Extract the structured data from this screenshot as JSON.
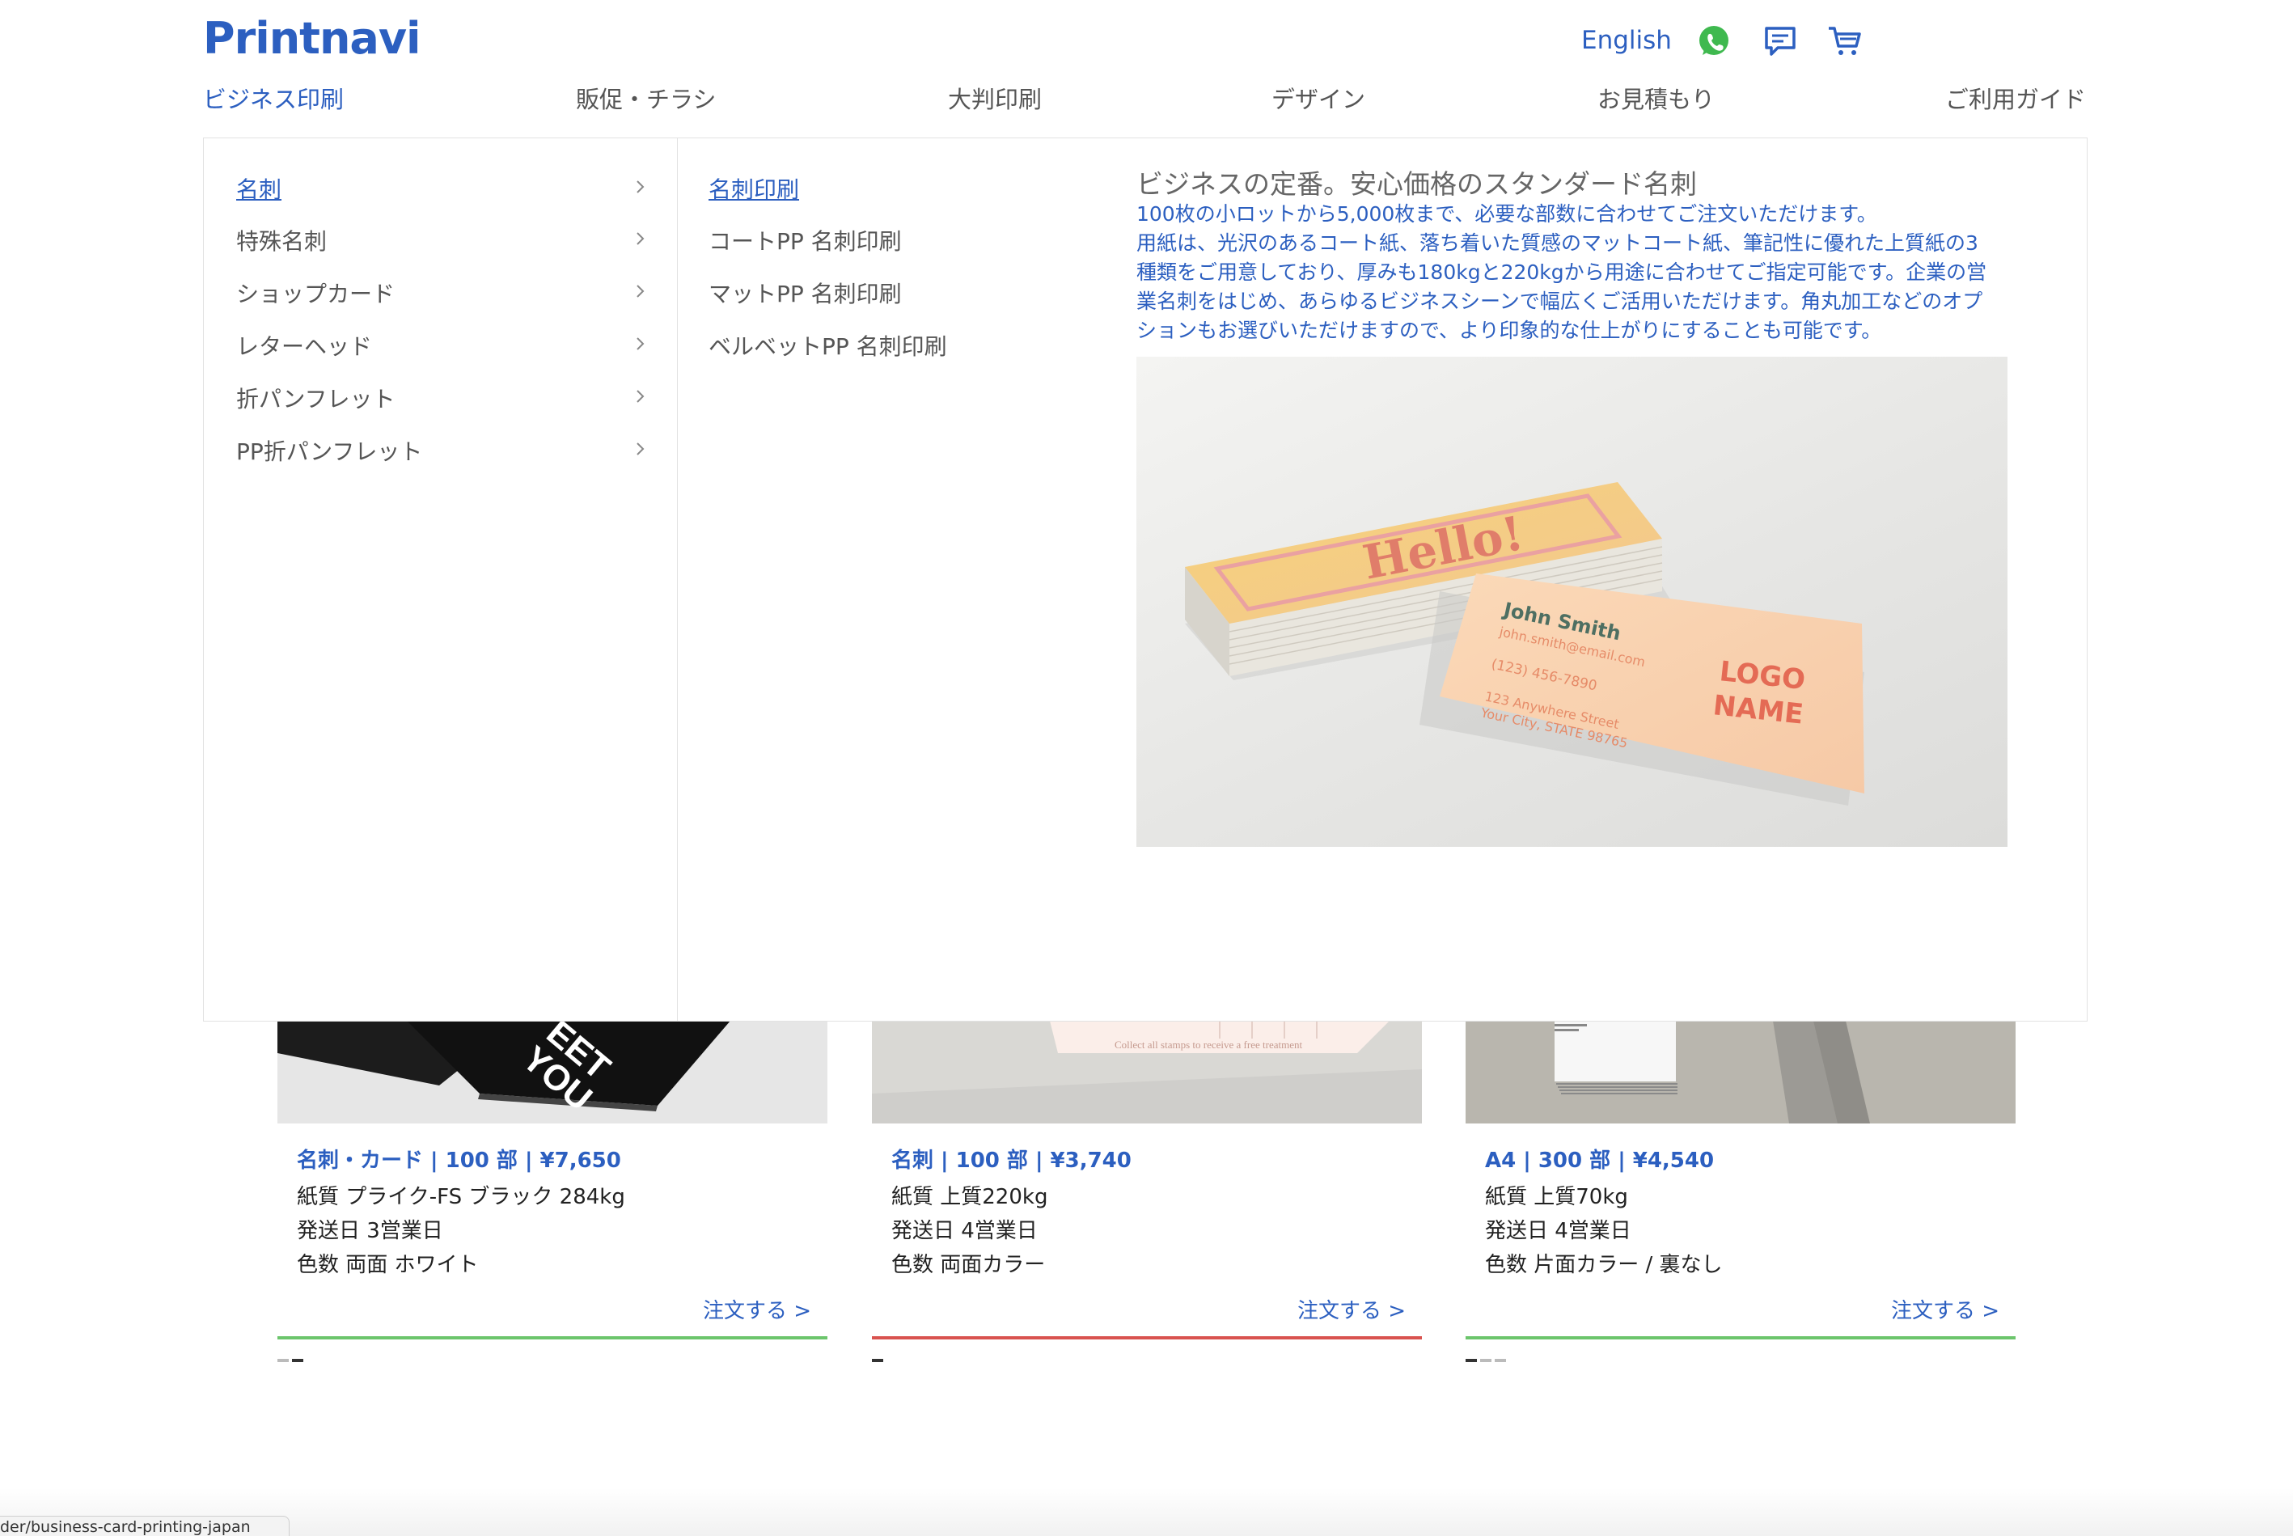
{
  "header": {
    "logo_text": "Printnavi",
    "language": "English",
    "icons": [
      "whatsapp-icon",
      "chat-icon",
      "cart-icon"
    ],
    "brand_color": "#2c5fc0"
  },
  "nav": [
    {
      "label": "ビジネス印刷",
      "active": true
    },
    {
      "label": "販促・チラシ"
    },
    {
      "label": "大判印刷"
    },
    {
      "label": "デザイン"
    },
    {
      "label": "お見積もり"
    },
    {
      "label": "ご利用ガイド"
    }
  ],
  "mega_menu": {
    "categories": [
      {
        "label": "名刺",
        "active": true
      },
      {
        "label": "特殊名刺"
      },
      {
        "label": "ショップカード"
      },
      {
        "label": "レターヘッド"
      },
      {
        "label": "折パンフレット"
      },
      {
        "label": "PP折パンフレット"
      }
    ],
    "subitems": [
      {
        "label": "名刺印刷",
        "active": true
      },
      {
        "label": "コートPP 名刺印刷"
      },
      {
        "label": "マットPP 名刺印刷"
      },
      {
        "label": "ベルベットPP 名刺印刷"
      }
    ],
    "promo": {
      "title": "ビジネスの定番。安心価格のスタンダード名刺",
      "description_lines": [
        "100枚の小ロットから5,000枚まで、必要な部数に合わせてご注文いただけます。",
        "用紙は、光沢のあるコート紙、落ち着いた質感のマットコート紙、筆記性に優れた上質紙の3",
        "種類をご用意しており、厚みも180kgと220kgから用途に合わせてご指定可能です。企業の営",
        "業名刺をはじめ、あらゆるビジネスシーンで幅広くご活用いただけます。角丸加工などのオプ",
        "ションもお選びいただけますので、より印象的な仕上がりにすることも可能です。"
      ],
      "image": {
        "card_front_text": "Hello!",
        "name": "John Smith",
        "email": "john.smith@email.com",
        "phone": "(123) 456-7890",
        "address_line1": "123 Anywhere Street",
        "address_line2": "Your City, STATE 98765",
        "logo_line1": "LOGO",
        "logo_line2": "NAME"
      }
    }
  },
  "product_cards": [
    {
      "image_text_1": "EET",
      "image_text_2": "YOU",
      "headline": "名刺・カード | 100 部 | ¥7,650",
      "paper": "紙質 プライク-FS ブラック 284kg",
      "ship": "発送日 3営業日",
      "colors": "色数 両面 ホワイト",
      "order": "注文する >",
      "line_color": "#6cc56c",
      "dots": 2,
      "active_dot": 1
    },
    {
      "image_text_1": "Collect all stamps to receive a free treatment",
      "headline": "名刺 | 100 部 | ¥3,740",
      "paper": "紙質 上質220kg",
      "ship": "発送日 4営業日",
      "colors": "色数 両面カラー",
      "order": "注文する >",
      "line_color": "#d9534f",
      "dots": 1,
      "active_dot": 0
    },
    {
      "headline": "A4 | 300 部 | ¥4,540",
      "paper": "紙質 上質70kg",
      "ship": "発送日 4営業日",
      "colors": "色数 片面カラー / 裏なし",
      "order": "注文する >",
      "line_color": "#6cc56c",
      "dots": 3,
      "active_dot": 0
    }
  ],
  "status_bar": {
    "url": "der/business-card-printing-japan"
  }
}
